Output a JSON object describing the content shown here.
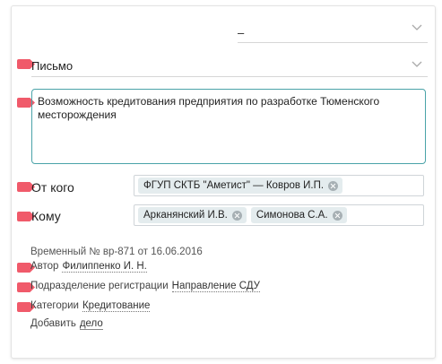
{
  "top_select": {
    "value": "–"
  },
  "doc_type_select": {
    "value": "Письмо"
  },
  "subject": {
    "value": "Возможность кредитования предприятия по разработке Тюменского месторождения"
  },
  "from_field": {
    "label": "От кого",
    "tokens": [
      {
        "text": "ФГУП СКТБ \"Аметист\" — Ковров И.П."
      }
    ]
  },
  "to_field": {
    "label": "Кому",
    "tokens": [
      {
        "text": "Арканянский И.В."
      },
      {
        "text": "Симонова С.А."
      }
    ]
  },
  "temp_number": "Временный № вр-871 от 16.06.2016",
  "author": {
    "label": "Автор",
    "value": "Филиппенко И. Н."
  },
  "department": {
    "label": "Подразделение регистрации",
    "value": "Направление СДУ"
  },
  "category": {
    "label": "Категории",
    "value": "Кредитование"
  },
  "add_case": {
    "prefix": "Добавить",
    "link": "дело"
  },
  "colors": {
    "marker": "#f05a6a",
    "focus_border": "#4aa3a8",
    "token_bg": "#e4ecee"
  }
}
